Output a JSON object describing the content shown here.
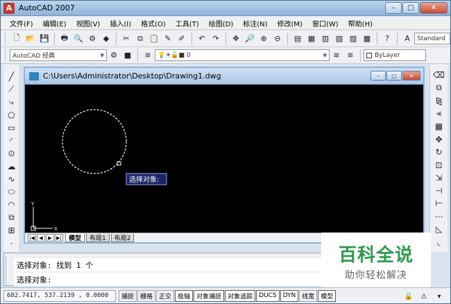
{
  "app": {
    "title": "AutoCAD 2007",
    "logo_letter": "A"
  },
  "window_buttons": {
    "minimize": "–",
    "maximize": "□",
    "close": "✕"
  },
  "menu": [
    "文件(F)",
    "编辑(E)",
    "视图(V)",
    "插入(I)",
    "格式(O)",
    "工具(T)",
    "绘图(D)",
    "标注(N)",
    "修改(M)",
    "窗口(W)",
    "帮助(H)"
  ],
  "toolbar2": {
    "workspace": "AutoCAD 经典",
    "layer_value": "0",
    "textstyle": "Standard",
    "color": "ByLayer"
  },
  "drawing": {
    "title": "C:\\Users\\Administrator\\Desktop\\Drawing1.dwg",
    "tooltip": "选择对象:",
    "ucs_y": "Y",
    "ucs_x": "X",
    "circle": {
      "selected": true
    }
  },
  "tabs": {
    "model": "模型",
    "layout1": "布局1",
    "layout2": "布局2"
  },
  "command": {
    "line1": "选择对象: 找到 1 个",
    "line2": "选择对象:"
  },
  "status": {
    "coords": "682.7417,  537.2139 , 0.0000",
    "buttons": [
      "捕捉",
      "栅格",
      "正交",
      "极轴",
      "对象捕捉",
      "对象追踪",
      "DUCS",
      "DYN",
      "线宽",
      "模型"
    ]
  },
  "watermark": {
    "main": "百科全说",
    "sub": "助你轻松解决"
  }
}
